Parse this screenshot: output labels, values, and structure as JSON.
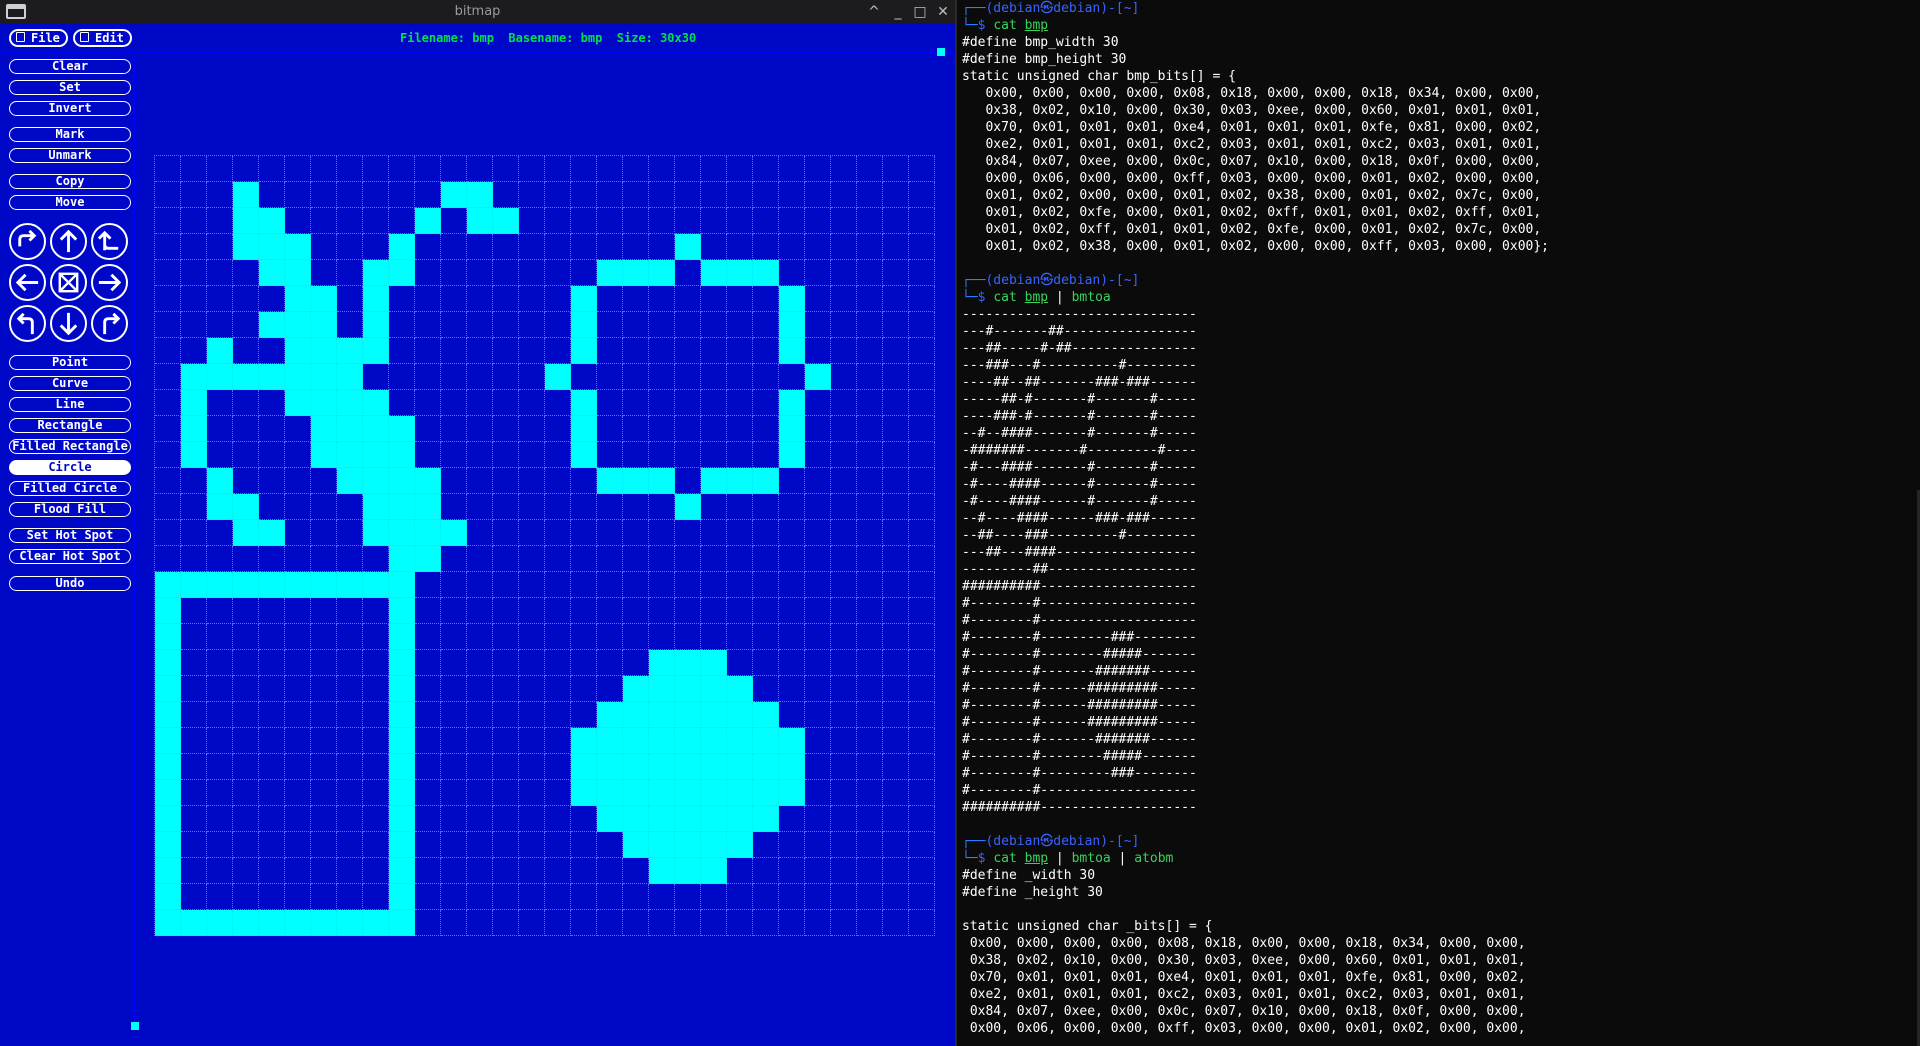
{
  "bitmap_window": {
    "title": "bitmap",
    "controls": [
      "^",
      "_",
      "□",
      "✕"
    ],
    "menus": [
      {
        "label": "File"
      },
      {
        "label": "Edit"
      }
    ],
    "status": "Filename: bmp  Basename: bmp  Size: 30x30",
    "tools": {
      "clear": "Clear",
      "set": "Set",
      "invert": "Invert",
      "mark": "Mark",
      "unmark": "Unmark",
      "copy": "Copy",
      "move": "Move",
      "point": "Point",
      "curve": "Curve",
      "line": "Line",
      "rectangle": "Rectangle",
      "filled_rectangle": "Filled Rectangle",
      "circle": "Circle",
      "filled_circle": "Filled Circle",
      "flood_fill": "Flood Fill",
      "set_hot_spot": "Set Hot Spot",
      "clear_hot_spot": "Clear Hot Spot",
      "undo": "Undo"
    },
    "selected_tool": "Circle",
    "arrow_buttons": [
      "flip-horizontal-icon",
      "up-arrow-icon",
      "flip-vertical-icon",
      "left-arrow-icon",
      "fold-icon",
      "right-arrow-icon",
      "rotate-left-icon",
      "down-arrow-icon",
      "rotate-right-icon"
    ],
    "grid_size": [
      30,
      30
    ],
    "pixel_rows": [
      "------------------------------",
      "---#-------##-----------------",
      "---##-----#-##----------------",
      "---###---#----------#---------",
      "----##--##-------###-###------",
      "-----##-#-------#-------#-----",
      "----###-#-------#-------#-----",
      "--#--####-------#-------#-----",
      "-#######-------#---------#----",
      "-#---####-------#-------#-----",
      "-#----####------#-------#-----",
      "-#----####------#-------#-----",
      "--#----####------###-###------",
      "--##----###---------#---------",
      "---##---####------------------",
      "---------##-------------------",
      "##########--------------------",
      "#--------#--------------------",
      "#--------#--------------------",
      "#--------#---------###--------",
      "#--------#--------#####-------",
      "#--------#-------#######------",
      "#--------#------#########-----",
      "#--------#------#########-----",
      "#--------#------#########-----",
      "#--------#-------#######------",
      "#--------#--------#####-------",
      "#--------#---------###--------",
      "#--------#--------------------",
      "##########--------------------"
    ],
    "on_color": "#00ffff",
    "bg_color": "#0008c8"
  },
  "terminal": {
    "lines": [
      {
        "t": "prompt"
      },
      {
        "t": "cmd",
        "parts": [
          [
            "cat ",
            "g"
          ],
          [
            "bmp",
            "gu"
          ]
        ]
      },
      {
        "t": "text",
        "s": "#define bmp_width 30"
      },
      {
        "t": "text",
        "s": "#define bmp_height 30"
      },
      {
        "t": "text",
        "s": "static unsigned char bmp_bits[] = {"
      },
      {
        "t": "text",
        "s": "   0x00, 0x00, 0x00, 0x00, 0x08, 0x18, 0x00, 0x00, 0x18, 0x34, 0x00, 0x00,"
      },
      {
        "t": "text",
        "s": "   0x38, 0x02, 0x10, 0x00, 0x30, 0x03, 0xee, 0x00, 0x60, 0x01, 0x01, 0x01,"
      },
      {
        "t": "text",
        "s": "   0x70, 0x01, 0x01, 0x01, 0xe4, 0x01, 0x01, 0x01, 0xfe, 0x81, 0x00, 0x02,"
      },
      {
        "t": "text",
        "s": "   0xe2, 0x01, 0x01, 0x01, 0xc2, 0x03, 0x01, 0x01, 0xc2, 0x03, 0x01, 0x01,"
      },
      {
        "t": "text",
        "s": "   0x84, 0x07, 0xee, 0x00, 0x0c, 0x07, 0x10, 0x00, 0x18, 0x0f, 0x00, 0x00,"
      },
      {
        "t": "text",
        "s": "   0x00, 0x06, 0x00, 0x00, 0xff, 0x03, 0x00, 0x00, 0x01, 0x02, 0x00, 0x00,"
      },
      {
        "t": "text",
        "s": "   0x01, 0x02, 0x00, 0x00, 0x01, 0x02, 0x38, 0x00, 0x01, 0x02, 0x7c, 0x00,"
      },
      {
        "t": "text",
        "s": "   0x01, 0x02, 0xfe, 0x00, 0x01, 0x02, 0xff, 0x01, 0x01, 0x02, 0xff, 0x01,"
      },
      {
        "t": "text",
        "s": "   0x01, 0x02, 0xff, 0x01, 0x01, 0x02, 0xfe, 0x00, 0x01, 0x02, 0x7c, 0x00,"
      },
      {
        "t": "text",
        "s": "   0x01, 0x02, 0x38, 0x00, 0x01, 0x02, 0x00, 0x00, 0xff, 0x03, 0x00, 0x00};"
      },
      {
        "t": "text",
        "s": ""
      },
      {
        "t": "prompt"
      },
      {
        "t": "cmd",
        "parts": [
          [
            "cat ",
            "g"
          ],
          [
            "bmp",
            "gu"
          ],
          [
            " | ",
            "w"
          ],
          [
            "bmtoa",
            "g"
          ]
        ]
      },
      {
        "t": "text",
        "s": "------------------------------"
      },
      {
        "t": "text",
        "s": "---#-------##-----------------"
      },
      {
        "t": "text",
        "s": "---##-----#-##----------------"
      },
      {
        "t": "text",
        "s": "---###---#----------#---------"
      },
      {
        "t": "text",
        "s": "----##--##-------###-###------"
      },
      {
        "t": "text",
        "s": "-----##-#-------#-------#-----"
      },
      {
        "t": "text",
        "s": "----###-#-------#-------#-----"
      },
      {
        "t": "text",
        "s": "--#--####-------#-------#-----"
      },
      {
        "t": "text",
        "s": "-#######-------#---------#----"
      },
      {
        "t": "text",
        "s": "-#---####-------#-------#-----"
      },
      {
        "t": "text",
        "s": "-#----####------#-------#-----"
      },
      {
        "t": "text",
        "s": "-#----####------#-------#-----"
      },
      {
        "t": "text",
        "s": "--#----####------###-###------"
      },
      {
        "t": "text",
        "s": "--##----###---------#---------"
      },
      {
        "t": "text",
        "s": "---##---####------------------"
      },
      {
        "t": "text",
        "s": "---------##-------------------"
      },
      {
        "t": "text",
        "s": "##########--------------------"
      },
      {
        "t": "text",
        "s": "#--------#--------------------"
      },
      {
        "t": "text",
        "s": "#--------#--------------------"
      },
      {
        "t": "text",
        "s": "#--------#---------###--------"
      },
      {
        "t": "text",
        "s": "#--------#--------#####-------"
      },
      {
        "t": "text",
        "s": "#--------#-------#######------"
      },
      {
        "t": "text",
        "s": "#--------#------#########-----"
      },
      {
        "t": "text",
        "s": "#--------#------#########-----"
      },
      {
        "t": "text",
        "s": "#--------#------#########-----"
      },
      {
        "t": "text",
        "s": "#--------#-------#######------"
      },
      {
        "t": "text",
        "s": "#--------#--------#####-------"
      },
      {
        "t": "text",
        "s": "#--------#---------###--------"
      },
      {
        "t": "text",
        "s": "#--------#--------------------"
      },
      {
        "t": "text",
        "s": "##########--------------------"
      },
      {
        "t": "text",
        "s": ""
      },
      {
        "t": "prompt"
      },
      {
        "t": "cmd",
        "parts": [
          [
            "cat ",
            "g"
          ],
          [
            "bmp",
            "gu"
          ],
          [
            " | ",
            "w"
          ],
          [
            "bmtoa",
            "g"
          ],
          [
            " | ",
            "w"
          ],
          [
            "atobm",
            "g"
          ]
        ]
      },
      {
        "t": "text",
        "s": "#define _width 30"
      },
      {
        "t": "text",
        "s": "#define _height 30"
      },
      {
        "t": "text",
        "s": ""
      },
      {
        "t": "text",
        "s": "static unsigned char _bits[] = {"
      },
      {
        "t": "text",
        "s": " 0x00, 0x00, 0x00, 0x00, 0x08, 0x18, 0x00, 0x00, 0x18, 0x34, 0x00, 0x00,"
      },
      {
        "t": "text",
        "s": " 0x38, 0x02, 0x10, 0x00, 0x30, 0x03, 0xee, 0x00, 0x60, 0x01, 0x01, 0x01,"
      },
      {
        "t": "text",
        "s": " 0x70, 0x01, 0x01, 0x01, 0xe4, 0x01, 0x01, 0x01, 0xfe, 0x81, 0x00, 0x02,"
      },
      {
        "t": "text",
        "s": " 0xe2, 0x01, 0x01, 0x01, 0xc2, 0x03, 0x01, 0x01, 0xc2, 0x03, 0x01, 0x01,"
      },
      {
        "t": "text",
        "s": " 0x84, 0x07, 0xee, 0x00, 0x0c, 0x07, 0x10, 0x00, 0x18, 0x0f, 0x00, 0x00,"
      },
      {
        "t": "text",
        "s": " 0x00, 0x06, 0x00, 0x00, 0xff, 0x03, 0x00, 0x00, 0x01, 0x02, 0x00, 0x00,"
      }
    ],
    "prompt_user": "(debian㉿debian)-[~]",
    "prompt_symbol": "$",
    "colors": {
      "prompt": "#3a62ff",
      "command": "#38d35a",
      "text": "#ffffff"
    }
  }
}
